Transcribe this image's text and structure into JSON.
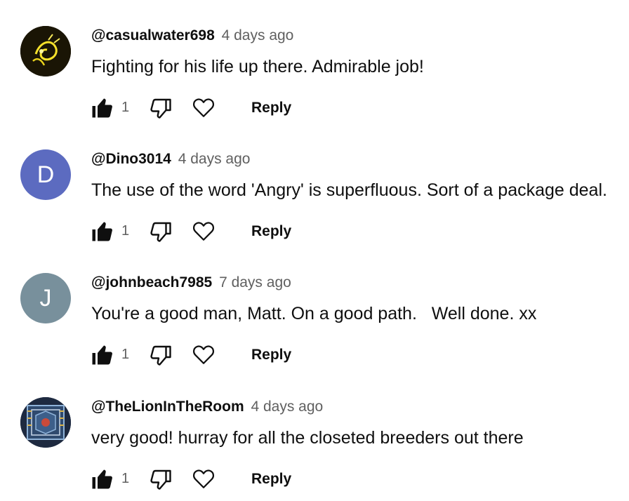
{
  "comments": [
    {
      "author": "@casualwater698",
      "time": "4 days ago",
      "text": "Fighting for his life up there. Admirable job!",
      "likes": "1",
      "reply_label": "Reply",
      "avatar": {
        "type": "image",
        "icon": "glowing-figure-avatar-image",
        "bg": "#1a1505",
        "accent": "#f5e12a"
      }
    },
    {
      "author": "@Dino3014",
      "time": "4 days ago",
      "text": "The use of the word 'Angry' is superfluous. Sort of a package deal.",
      "likes": "1",
      "reply_label": "Reply",
      "avatar": {
        "type": "letter",
        "letter": "D",
        "bg": "#5c6bc0"
      }
    },
    {
      "author": "@johnbeach7985",
      "time": "7 days ago",
      "text": "You're a good man, Matt. On a good path.   Well done. xx",
      "likes": "1",
      "reply_label": "Reply",
      "avatar": {
        "type": "letter",
        "letter": "J",
        "bg": "#78909c"
      }
    },
    {
      "author": "@TheLionInTheRoom",
      "time": "4 days ago",
      "text": "very good! hurray for all the closeted breeders out there",
      "likes": "1",
      "reply_label": "Reply",
      "avatar": {
        "type": "image",
        "icon": "patterned-tapestry-avatar-image",
        "bg": "#2b3a55",
        "accent": "#8fb3d9"
      }
    }
  ],
  "colors": {
    "text_primary": "#0f0f0f",
    "text_secondary": "#606060",
    "background": "#ffffff"
  }
}
